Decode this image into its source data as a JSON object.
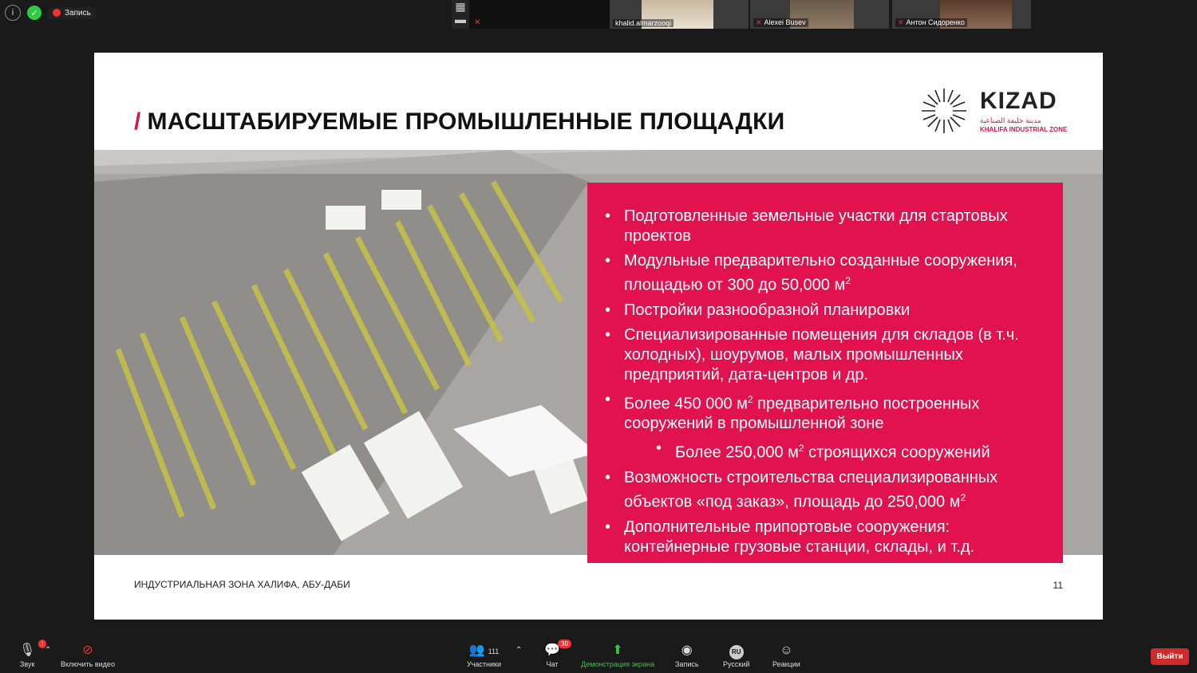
{
  "top_bar": {
    "info_icon": "info-icon",
    "shield_icon": "shield-icon",
    "recording_label": "Запись"
  },
  "participants_tiles": [
    {
      "name": "khalid.almarzooqi",
      "muted": false
    },
    {
      "name": "Alexei Busev",
      "muted": true
    },
    {
      "name": "Антон Сидоренко",
      "muted": true
    }
  ],
  "slide": {
    "title": "МАСШТАБИРУЕМЫЕ ПРОМЫШЛЕННЫЕ ПЛОЩАДКИ",
    "title_prefix": "/",
    "logo": {
      "name": "KIZAD",
      "arabic": "مدينة خليفة الصناعية",
      "subtitle": "KHALIFA INDUSTRIAL ZONE"
    },
    "bullets": [
      {
        "text": "Подготовленные земельные участки для стартовых проектов"
      },
      {
        "text": "Модульные предварительно созданные сооружения, площадью от 300 до 50,000 м",
        "sup": "2"
      },
      {
        "text": "Постройки разнообразной планировки"
      },
      {
        "text": "Специализированные помещения для складов (в т.ч. холодных), шоурумов, малых промышленных предприятий, дата-центров и др."
      },
      {
        "text": "Более 450 000 м",
        "sup": "2",
        "text_after": " предварительно построенных сооружений в промышленной зоне"
      },
      {
        "text": "Более 250,000 м",
        "sup": "2",
        "text_after": " строящихся сооружений",
        "sub": true
      },
      {
        "text": "Возможность строительства специализированных объектов «под заказ», площадь до 250,000 м",
        "sup": "2"
      },
      {
        "text": "Дополнительные припортовые сооружения: контейнерные грузовые станции, склады, и т.д."
      }
    ],
    "footer_left": "ИНДУСТРИАЛЬНАЯ ЗОНА ХАЛИФА, АБУ-ДАБИ",
    "page_number": "11",
    "accent_color": "#e1124f"
  },
  "toolbar": {
    "audio": {
      "label": "Звук",
      "badge": "!"
    },
    "video": {
      "label": "Включить видео"
    },
    "participants": {
      "label": "Участники",
      "count": "111"
    },
    "chat": {
      "label": "Чат",
      "badge": "30"
    },
    "share": {
      "label": "Демонстрация экрана"
    },
    "record": {
      "label": "Запись"
    },
    "language": {
      "label": "Русский",
      "code": "RU"
    },
    "reactions": {
      "label": "Реакции"
    },
    "leave": {
      "label": "Выйти"
    }
  }
}
